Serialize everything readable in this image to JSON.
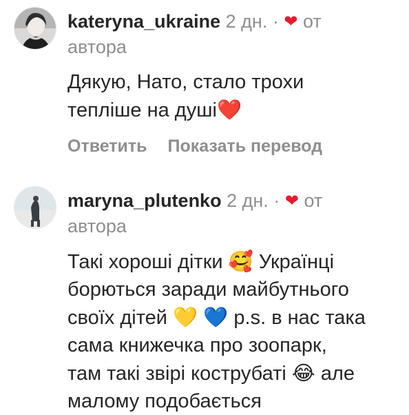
{
  "comments": [
    {
      "username": "kateryna_ukraine",
      "time": "2 дн.",
      "dot": "·",
      "heart": "❤",
      "from": "от",
      "author": "автора",
      "text_line1": "Дякую, Нато, стало трохи",
      "text_line2": "тепліше на душі",
      "text_emoji": "❤️",
      "actions": {
        "reply": "Ответить",
        "translate": "Показать перевод"
      }
    },
    {
      "username": "maryna_plutenko",
      "time": "2 дн.",
      "dot": "·",
      "heart": "❤",
      "from": "от",
      "author": "автора",
      "text": {
        "l1a": "Такі хороші дітки",
        "l1emoji": "🥰",
        "l1b": "Українці",
        "l2": "борються заради майбутнього",
        "l3a": "своїх дітей",
        "l3emoji1": "💛",
        "l3emoji2": "💙",
        "l3b": "p.s. в нас така",
        "l4": "сама книжечка про зоопарк,",
        "l5a": "там такі звірі кострубаті",
        "l5emoji": "😂",
        "l5b": "але",
        "l6": "малому подобається"
      }
    }
  ],
  "colors": {
    "text": "#262626",
    "muted": "#8e8e8e",
    "heart": "#e8192c"
  }
}
